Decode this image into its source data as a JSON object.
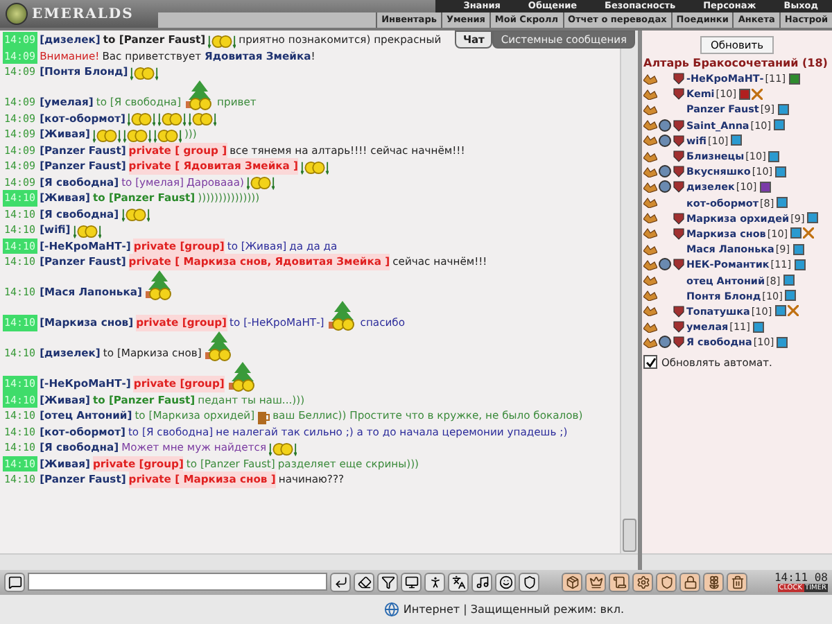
{
  "header": {
    "logo": "EMERALDS",
    "main_menu": [
      "Знания",
      "Общение",
      "Безопасность",
      "Персонаж",
      "Выход"
    ],
    "sub_menu": [
      "Инвентарь",
      "Умения",
      "Мой Скролл",
      "Отчет о переводах",
      "Поединки",
      "Анкета",
      "Настрой"
    ]
  },
  "chat_tabs": [
    {
      "label": "Чат",
      "selected": true
    },
    {
      "label": "Системные сообщения",
      "selected": false
    }
  ],
  "messages": [
    {
      "time": "14:09",
      "highlight": true,
      "kind": "dark",
      "parts": [
        {
          "kind": "nick",
          "text": "[дизелек]"
        },
        {
          "kind": "to_bold",
          "text": "to [Panzer Faust]"
        },
        {
          "kind": "smiley"
        },
        {
          "kind": "text",
          "text": "приятно познакомится) прекрасный"
        }
      ]
    },
    {
      "time": "14:09",
      "highlight": true,
      "kind": "dark",
      "parts": [
        {
          "kind": "alert",
          "text": "Внимание!"
        },
        {
          "kind": "rich",
          "text": "Вас приветствует **Ядовитая Змейка**!"
        }
      ]
    },
    {
      "time": "14:09",
      "highlight": false,
      "kind": "dark",
      "parts": [
        {
          "kind": "nick",
          "text": "[Понтя Блонд]"
        },
        {
          "kind": "smiley"
        }
      ]
    },
    {
      "time": "14:09",
      "highlight": false,
      "kind": "green",
      "parts": [
        {
          "kind": "nick",
          "text": "[умелая]"
        },
        {
          "kind": "to",
          "text": "to [Я свободна]"
        },
        {
          "kind": "tree"
        },
        {
          "kind": "text",
          "text": "привет"
        }
      ]
    },
    {
      "time": "14:09",
      "highlight": false,
      "kind": "dark",
      "parts": [
        {
          "kind": "nick",
          "text": "[кот-обормот]"
        },
        {
          "kind": "smiley"
        },
        {
          "kind": "smiley"
        },
        {
          "kind": "smiley"
        }
      ]
    },
    {
      "time": "14:09",
      "highlight": false,
      "kind": "green",
      "parts": [
        {
          "kind": "nick",
          "text": "[Живая]"
        },
        {
          "kind": "smiley"
        },
        {
          "kind": "smiley"
        },
        {
          "kind": "smiley"
        },
        {
          "kind": "text",
          "text": ")))"
        }
      ]
    },
    {
      "time": "14:09",
      "highlight": false,
      "kind": "dark",
      "parts": [
        {
          "kind": "nick",
          "text": "[Panzer Faust]"
        },
        {
          "kind": "private",
          "text": "private [ group ]"
        },
        {
          "kind": "text",
          "text": "все тянемя на алтарь!!!! сейчас начнём!!!"
        }
      ]
    },
    {
      "time": "14:09",
      "highlight": false,
      "kind": "dark",
      "parts": [
        {
          "kind": "nick",
          "text": "[Panzer Faust]"
        },
        {
          "kind": "private",
          "text": "private [ Ядовитая Змейка ]"
        },
        {
          "kind": "smiley"
        }
      ]
    },
    {
      "time": "14:09",
      "highlight": false,
      "kind": "purple",
      "parts": [
        {
          "kind": "nick",
          "text": "[Я свободна]"
        },
        {
          "kind": "to",
          "text": "to [умелая]"
        },
        {
          "kind": "text",
          "text": "Даровааа)"
        },
        {
          "kind": "smiley"
        }
      ]
    },
    {
      "time": "14:10",
      "highlight": true,
      "kind": "green",
      "parts": [
        {
          "kind": "nick",
          "text": "[Живая]"
        },
        {
          "kind": "to_green",
          "text": "to [Panzer Faust]"
        },
        {
          "kind": "text",
          "text": ")))))))))))))))"
        }
      ]
    },
    {
      "time": "14:10",
      "highlight": false,
      "kind": "dark",
      "parts": [
        {
          "kind": "nick",
          "text": "[Я свободна]"
        },
        {
          "kind": "smiley"
        }
      ]
    },
    {
      "time": "14:10",
      "highlight": false,
      "kind": "dark",
      "parts": [
        {
          "kind": "nick",
          "text": "[wifi]"
        },
        {
          "kind": "smiley"
        }
      ]
    },
    {
      "time": "14:10",
      "highlight": true,
      "kind": "blue",
      "parts": [
        {
          "kind": "nick",
          "text": "[-НеКроМаНТ-]"
        },
        {
          "kind": "private",
          "text": "private [group]"
        },
        {
          "kind": "to",
          "text": "to [Живая]"
        },
        {
          "kind": "text",
          "text": "да да да"
        }
      ]
    },
    {
      "time": "14:10",
      "highlight": false,
      "kind": "dark",
      "parts": [
        {
          "kind": "nick",
          "text": "[Panzer Faust]"
        },
        {
          "kind": "private",
          "text": "private [ Маркиза снов, Ядовитая Змейка ]"
        },
        {
          "kind": "text",
          "text": "сейчас начнём!!!"
        }
      ]
    },
    {
      "time": "14:10",
      "highlight": false,
      "kind": "dark",
      "parts": [
        {
          "kind": "nick",
          "text": "[Мася Лапонька]"
        },
        {
          "kind": "tree"
        }
      ]
    },
    {
      "time": "14:10",
      "highlight": true,
      "kind": "blue",
      "parts": [
        {
          "kind": "nick",
          "text": "[Маркиза снов]"
        },
        {
          "kind": "private",
          "text": "private [group]"
        },
        {
          "kind": "to",
          "text": "to [-НеКроМаНТ-]"
        },
        {
          "kind": "tree"
        },
        {
          "kind": "text",
          "text": "спасибо"
        }
      ]
    },
    {
      "time": "14:10",
      "highlight": false,
      "kind": "dark",
      "parts": [
        {
          "kind": "nick",
          "text": "[дизелек]"
        },
        {
          "kind": "to",
          "text": "to [Маркиза снов]"
        },
        {
          "kind": "tree"
        }
      ]
    },
    {
      "time": "14:10",
      "highlight": true,
      "kind": "dark",
      "parts": [
        {
          "kind": "nick",
          "text": "[-НеКроМаНТ-]"
        },
        {
          "kind": "private",
          "text": "private [group]"
        },
        {
          "kind": "tree"
        }
      ]
    },
    {
      "time": "14:10",
      "highlight": true,
      "kind": "green",
      "parts": [
        {
          "kind": "nick",
          "text": "[Живая]"
        },
        {
          "kind": "to_green",
          "text": "to [Panzer Faust]"
        },
        {
          "kind": "text",
          "text": "педант ты наш...)))"
        }
      ]
    },
    {
      "time": "14:10",
      "highlight": false,
      "kind": "green",
      "parts": [
        {
          "kind": "nick",
          "text": "[отец Антоний]"
        },
        {
          "kind": "to",
          "text": "to [Маркиза орхидей]"
        },
        {
          "kind": "mug"
        },
        {
          "kind": "text",
          "text": "ваш Беллис)) Простите что в кружке, не было бокалов)"
        }
      ]
    },
    {
      "time": "14:10",
      "highlight": false,
      "kind": "blue",
      "parts": [
        {
          "kind": "nick",
          "text": "[кот-обормот]"
        },
        {
          "kind": "to",
          "text": "to [Я свободна]"
        },
        {
          "kind": "text",
          "text": "не налегай так сильно ;) а то до начала церемонии упадешь ;)"
        }
      ]
    },
    {
      "time": "14:10",
      "highlight": false,
      "kind": "purple",
      "parts": [
        {
          "kind": "nick",
          "text": "[Я свободна]"
        },
        {
          "kind": "text",
          "text": "Может мне муж найдется"
        },
        {
          "kind": "smiley"
        }
      ]
    },
    {
      "time": "14:10",
      "highlight": true,
      "kind": "green",
      "parts": [
        {
          "kind": "nick",
          "text": "[Живая]"
        },
        {
          "kind": "private",
          "text": "private [group]"
        },
        {
          "kind": "to",
          "text": "to [Panzer Faust]"
        },
        {
          "kind": "text",
          "text": "разделяет еще скрины)))"
        }
      ]
    },
    {
      "time": "14:10",
      "highlight": false,
      "kind": "dark",
      "parts": [
        {
          "kind": "nick",
          "text": "[Panzer Faust]"
        },
        {
          "kind": "private",
          "text": "private [ Маркиза снов ]"
        },
        {
          "kind": "text",
          "text": "начинаю???"
        }
      ]
    }
  ],
  "room": {
    "refresh_button": "Обновить",
    "title": "Алтарь Бракосочетаний (18)",
    "users": [
      {
        "name": "-НеКроМаНТ-",
        "level": "[11]",
        "color": "#2e8b2e",
        "emblem": true,
        "align": false,
        "crossed": false
      },
      {
        "name": "Kemi",
        "level": "[10]",
        "color": "#b02020",
        "emblem": true,
        "align": false,
        "crossed": true
      },
      {
        "name": "Panzer Faust",
        "level": "[9]",
        "color": "#2a9ad0",
        "emblem": false,
        "align": false,
        "crossed": false
      },
      {
        "name": "Saint_Anna",
        "level": "[10]",
        "color": "#2a9ad0",
        "emblem": true,
        "align": true,
        "crossed": false
      },
      {
        "name": "wifi",
        "level": "[10]",
        "color": "#2a9ad0",
        "emblem": true,
        "align": true,
        "crossed": false
      },
      {
        "name": "Близнецы",
        "level": "[10]",
        "color": "#2a9ad0",
        "emblem": true,
        "align": false,
        "crossed": false
      },
      {
        "name": "Вкусняшко",
        "level": "[10]",
        "color": "#2a9ad0",
        "emblem": true,
        "align": true,
        "crossed": false
      },
      {
        "name": "дизелек",
        "level": "[10]",
        "color": "#7a3aa8",
        "emblem": true,
        "align": true,
        "crossed": false
      },
      {
        "name": "кот-обормот",
        "level": "[8]",
        "color": "#2a9ad0",
        "emblem": false,
        "align": false,
        "crossed": false
      },
      {
        "name": "Маркиза орхидей",
        "level": "[9]",
        "color": "#2a9ad0",
        "emblem": true,
        "align": false,
        "crossed": false
      },
      {
        "name": "Маркиза снов",
        "level": "[10]",
        "color": "#2a9ad0",
        "emblem": true,
        "align": false,
        "crossed": true
      },
      {
        "name": "Мася Лапонька",
        "level": "[9]",
        "color": "#2a9ad0",
        "emblem": false,
        "align": false,
        "crossed": false
      },
      {
        "name": "НЕК-Романтик",
        "level": "[11]",
        "color": "#2a9ad0",
        "emblem": true,
        "align": true,
        "crossed": false
      },
      {
        "name": "отец Антоний",
        "level": "[8]",
        "color": "#2a9ad0",
        "emblem": false,
        "align": false,
        "crossed": false
      },
      {
        "name": "Понтя Блонд",
        "level": "[10]",
        "color": "#2a9ad0",
        "emblem": false,
        "align": false,
        "crossed": false
      },
      {
        "name": "Топатушка",
        "level": "[10]",
        "color": "#2a9ad0",
        "emblem": true,
        "align": false,
        "crossed": true
      },
      {
        "name": "умелая",
        "level": "[11]",
        "color": "#2a9ad0",
        "emblem": true,
        "align": false,
        "crossed": false
      },
      {
        "name": "Я свободна",
        "level": "[10]",
        "color": "#2a9ad0",
        "emblem": true,
        "align": true,
        "crossed": false
      }
    ],
    "auto_refresh": {
      "label": "Обновлять автомат.",
      "checked": true
    }
  },
  "clock": {
    "time": "14:11",
    "seconds": "08",
    "clock_label": "CLOCK",
    "timer_label": "TIMER"
  },
  "status_bar": {
    "text": "Интернет | Защищенный режим: вкл."
  }
}
